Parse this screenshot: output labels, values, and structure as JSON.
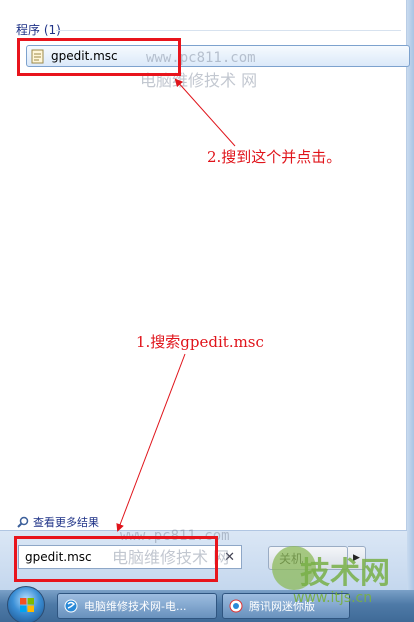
{
  "results": {
    "group_header": "程序 (1)",
    "item_label": "gpedit.msc",
    "see_more": "查看更多结果"
  },
  "search": {
    "value": "gpedit.msc"
  },
  "shutdown": {
    "label": "关机"
  },
  "taskbar": {
    "items": [
      {
        "label": "电脑维修技术网-电..."
      },
      {
        "label": "腾讯网迷你版"
      }
    ]
  },
  "annotations": {
    "step1": "1.搜索gpedit.msc",
    "step2": "2.搜到这个并点击。"
  },
  "watermarks": {
    "url": "www.pc811.com",
    "cn": "电脑维修技术 网",
    "logo_text": "技术网",
    "site": "www.itjs.cn"
  },
  "colors": {
    "annotation_red": "#e8141c",
    "header_blue": "#1e3287"
  }
}
